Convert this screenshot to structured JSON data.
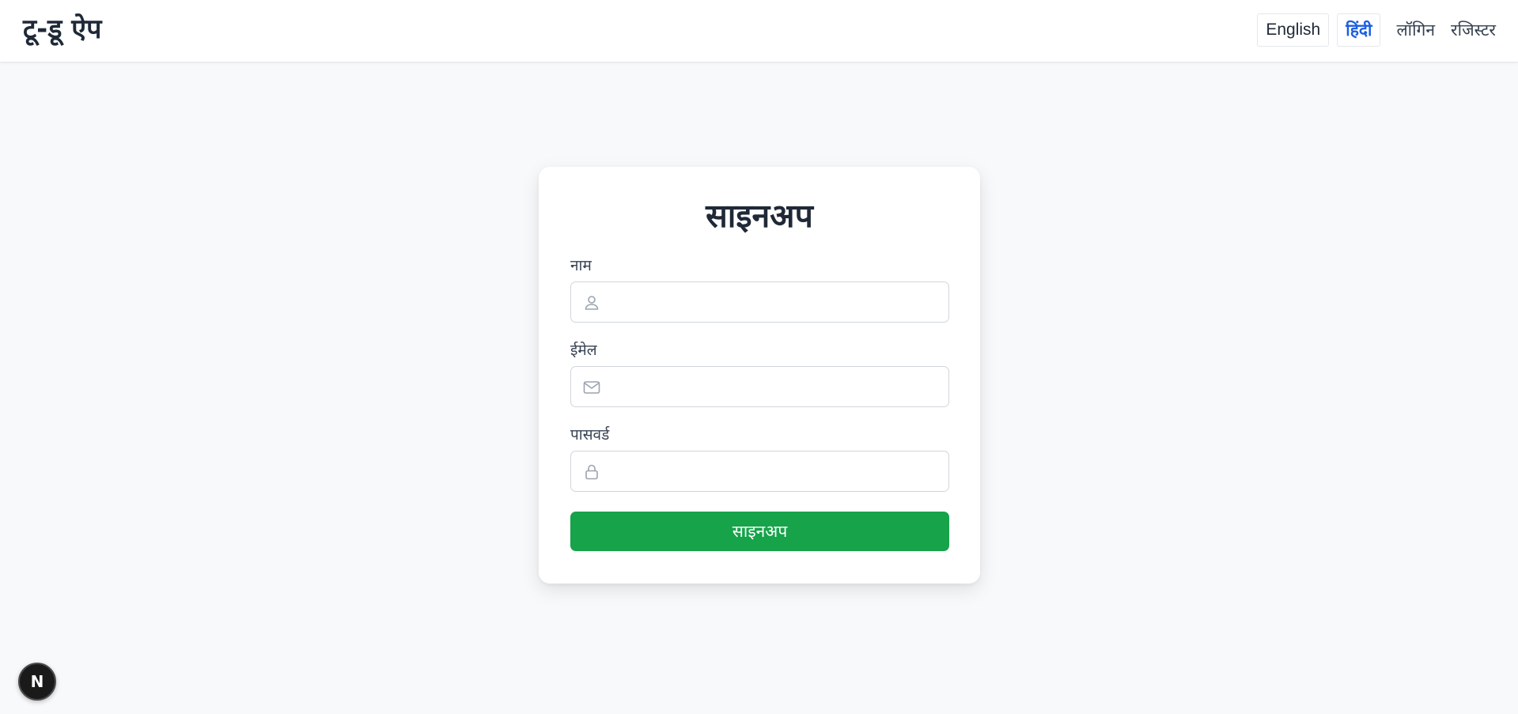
{
  "navbar": {
    "brand": "टू-डू ऐप",
    "languages": [
      {
        "label": "English",
        "active": false
      },
      {
        "label": "हिंदी",
        "active": true
      }
    ],
    "links": {
      "login": "लॉगिन",
      "register": "रजिस्टर"
    }
  },
  "form": {
    "title": "साइनअप",
    "fields": [
      {
        "label": "नाम",
        "icon": "user-icon",
        "value": "",
        "placeholder": ""
      },
      {
        "label": "ईमेल",
        "icon": "mail-icon",
        "value": "",
        "placeholder": ""
      },
      {
        "label": "पासवर्ड",
        "icon": "lock-icon",
        "value": "",
        "placeholder": ""
      }
    ],
    "submit_label": "साइनअप"
  },
  "dev_badge": {
    "letter": "N",
    "icon": "nextjs-icon"
  },
  "colors": {
    "accent_blue": "#1d5fe0",
    "submit_green": "#16a34a",
    "background": "#f8f9fb"
  }
}
